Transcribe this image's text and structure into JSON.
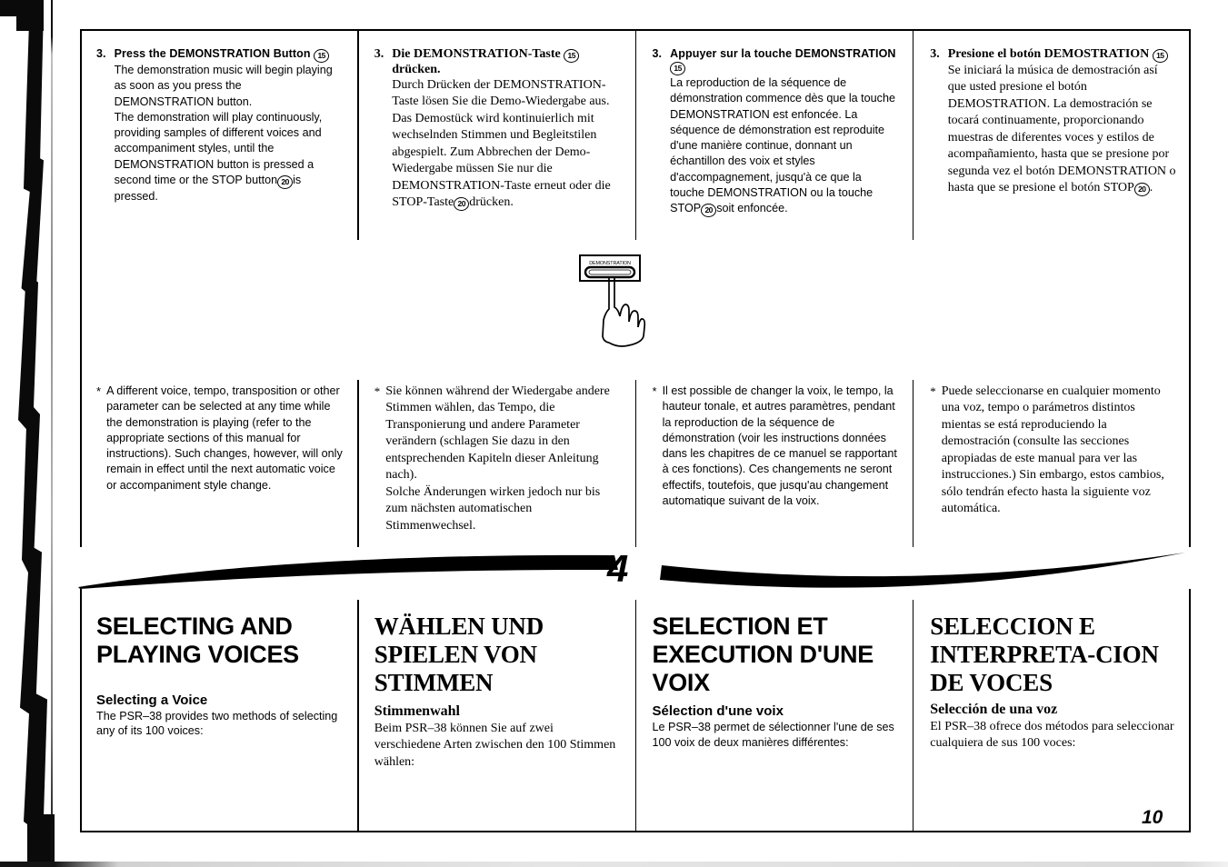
{
  "page": {
    "number": "10",
    "chapter_number": "4"
  },
  "step": {
    "number": "3.",
    "columns": [
      {
        "lang": "en",
        "heading_before": "Press the DEMONSTRATION Button",
        "heading_badge": "15",
        "heading_after": "",
        "body": "The demonstration music will begin playing as soon as you press the DEMONSTRATION button.\nThe demonstration will play continuously, providing samples of different voices and accompaniment styles, until the DEMONSTRATION button is pressed a second time or the STOP button ⑳ is pressed.",
        "body_part1": "The demonstration music will begin playing as soon as you press the DEMONSTRATION button.",
        "body_part2": "The demonstration will play continuously, providing samples of different voices and accompaniment styles, until the DEMONSTRATION button is pressed a second time or the STOP button",
        "body_badge": "20",
        "body_part3": "is pressed."
      },
      {
        "lang": "de",
        "heading_before": "Die DEMONSTRATION-Taste",
        "heading_badge": "15",
        "heading_after": "drücken.",
        "body_part1": "Durch Drücken der DEMONSTRATION-Taste lösen Sie die Demo-Wiedergabe aus.",
        "body_part2": "Das Demostück wird kontinuierlich mit wechselnden Stimmen und Begleitstilen abgespielt. Zum Abbrechen der Demo-Wiedergabe müssen Sie nur die DEMONSTRATION-Taste erneut oder die STOP-Taste",
        "body_badge": "20",
        "body_part3": "drücken."
      },
      {
        "lang": "fr",
        "heading_before": "Appuyer sur la touche DEMONSTRATION",
        "heading_badge": "15",
        "heading_after": "",
        "body_part1": "La reproduction de la séquence de démonstration commence dès que la touche DEMONSTRATION est enfoncée. La séquence de démonstration est reproduite d'une manière continue, donnant un échantillon des voix et styles d'accompagnement, jusqu'à ce que la touche DEMONSTRATION ou la touche STOP",
        "body_part2": "",
        "body_badge": "20",
        "body_part3": "soit enfoncée."
      },
      {
        "lang": "es",
        "heading_before": "Presione el botón DEMOSTRATION",
        "heading_badge": "15",
        "heading_after": "",
        "body_part1": "Se iniciará la música de demostración así que usted presione el botón DEMOSTRATION. La demostración se tocará continuamente, proporcionando muestras de diferentes voces y estilos de acompañamiento, hasta que se presione por segunda vez el botón DEMONSTRATION o hasta que se presione el botón STOP",
        "body_part2": "",
        "body_badge": "20",
        "body_part3": "."
      }
    ]
  },
  "illustration": {
    "button_label": "DEMONSTRATION",
    "alt": "finger pressing the DEMONSTRATION button"
  },
  "notes": {
    "star": "*",
    "columns": [
      {
        "lang": "en",
        "text": "A different voice, tempo, transposition or other parameter can be selected at any time while the demonstration is playing (refer to the appropriate sections of this manual for instructions). Such changes, however, will only remain in effect until the next automatic voice or accompaniment style change."
      },
      {
        "lang": "de",
        "text": "Sie können während der Wiedergabe andere Stimmen wählen, das Tempo, die Transponierung und andere Parameter verändern (schlagen Sie dazu in den entsprechenden Kapiteln dieser Anleitung nach).\nSolche Änderungen wirken jedoch nur bis zum nächsten automatischen Stimmenwechsel."
      },
      {
        "lang": "fr",
        "text": "Il est possible de changer la voix, le tempo, la hauteur tonale, et autres paramètres, pendant la reproduction de la séquence de démonstration (voir les instructions données dans les chapitres de ce manuel se rapportant à ces fonctions). Ces changements ne seront effectifs, toutefois, que jusqu'au changement automatique suivant de la voix."
      },
      {
        "lang": "es",
        "text": "Puede seleccionarse en cualquier momento una voz, tempo o parámetros distintos mientas se está reproduciendo la demostración (consulte las secciones apropiadas de este manual para ver las instrucciones.) Sin embargo, estos cambios, sólo tendrán efecto hasta la siguiente voz automática."
      }
    ]
  },
  "section": {
    "columns": [
      {
        "lang": "en",
        "title": "SELECTING AND PLAYING VOICES",
        "subtitle": "Selecting a Voice",
        "body": "The PSR–38 provides two methods of selecting any of its 100 voices:"
      },
      {
        "lang": "de",
        "title": "WÄHLEN UND SPIELEN VON STIMMEN",
        "subtitle": "Stimmenwahl",
        "body": "Beim PSR–38 können Sie auf zwei verschiedene Arten zwischen den 100 Stimmen wählen:"
      },
      {
        "lang": "fr",
        "title": "SELECTION ET EXECUTION D'UNE VOIX",
        "subtitle": "Sélection d'une voix",
        "body": "Le PSR–38 permet de sélectionner l'une de ses 100 voix de deux manières différentes:"
      },
      {
        "lang": "es",
        "title": "SELECCION E INTERPRETA-CION DE VOCES",
        "subtitle": "Selección de una voz",
        "body": "El PSR–38 ofrece dos métodos para seleccionar cualquiera de sus 100 voces:"
      }
    ]
  },
  "colors": {
    "ink": "#000000",
    "paper": "#ffffff"
  }
}
